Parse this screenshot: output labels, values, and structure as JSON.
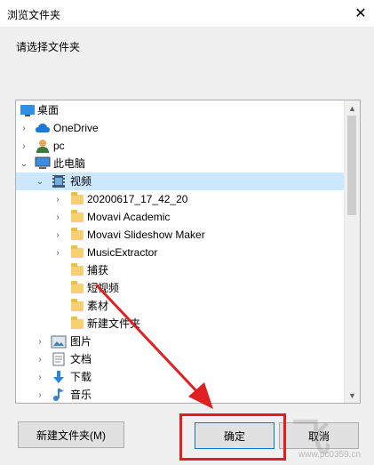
{
  "window": {
    "title": "浏览文件夹",
    "close_glyph": "✕"
  },
  "description": "请选择文件夹",
  "tree": {
    "items": [
      {
        "label": "桌面",
        "icon": "desktop-icon",
        "expander": ""
      },
      {
        "label": "OneDrive",
        "icon": "cloud-icon",
        "expander": "›"
      },
      {
        "label": "pc",
        "icon": "user-icon",
        "expander": "›"
      },
      {
        "label": "此电脑",
        "icon": "computer-icon",
        "expander": "⌄"
      },
      {
        "label": "视频",
        "icon": "video-folder-icon",
        "expander": "⌄",
        "selected": true
      },
      {
        "label": "20200617_17_42_20",
        "icon": "folder-icon",
        "expander": "›"
      },
      {
        "label": "Movavi Academic",
        "icon": "folder-icon",
        "expander": "›"
      },
      {
        "label": "Movavi Slideshow Maker",
        "icon": "folder-icon",
        "expander": "›"
      },
      {
        "label": "MusicExtractor",
        "icon": "folder-icon",
        "expander": "›"
      },
      {
        "label": "捕获",
        "icon": "folder-icon",
        "expander": ""
      },
      {
        "label": "短视频",
        "icon": "folder-icon",
        "expander": ""
      },
      {
        "label": "素材",
        "icon": "folder-icon",
        "expander": ""
      },
      {
        "label": "新建文件夹",
        "icon": "folder-icon",
        "expander": ""
      },
      {
        "label": "图片",
        "icon": "pictures-icon",
        "expander": "›"
      },
      {
        "label": "文档",
        "icon": "documents-icon",
        "expander": "›"
      },
      {
        "label": "下载",
        "icon": "downloads-icon",
        "expander": "›"
      },
      {
        "label": "音乐",
        "icon": "music-icon",
        "expander": "›"
      }
    ]
  },
  "buttons": {
    "new_folder": "新建文件夹(M)",
    "ok": "确定",
    "cancel": "取消"
  },
  "watermark": {
    "text": "飞",
    "sub": "www.pc0359.cn"
  },
  "colors": {
    "highlight": "#e02020",
    "selection": "#cce8ff",
    "accent": "#0078d7"
  }
}
